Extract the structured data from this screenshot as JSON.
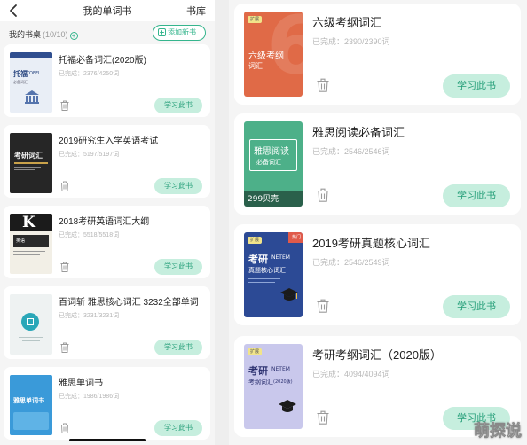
{
  "left": {
    "nav": {
      "title": "我的单词书",
      "library": "书库"
    },
    "shelf": {
      "label": "我的书桌",
      "count": "(10/10)",
      "plus": "+",
      "add_button": "添加新书"
    },
    "books": [
      {
        "name": "托福必备词汇(2020版)",
        "done": "已完成：2376/4250词",
        "study": "学习此书",
        "cover_title": "托福",
        "cover_sub": "TOEFL",
        "cover_note": "必备词汇"
      },
      {
        "name": "2019研究生入学英语考试",
        "done": "已完成：5197/5197词",
        "study": "学习此书",
        "cover_title": "考研词汇"
      },
      {
        "name": "2018考研英语词汇大纲",
        "done": "已完成：5518/5518词",
        "study": "学习此书",
        "cover_badge": "英语",
        "cover_letter": "K"
      },
      {
        "name": "百词斩 雅思核心词汇 3232全部单词",
        "done": "已完成：3231/3231词",
        "study": "学习此书"
      },
      {
        "name": "雅思单词书",
        "done": "已完成：1986/1986词",
        "study": "学习此书",
        "cover_title": "雅思单词书"
      }
    ]
  },
  "right": {
    "books": [
      {
        "name": "六级考纲词汇",
        "done": "已完成：2390/2390词",
        "study": "学习此书",
        "cover_title": "六级考纲",
        "cover_sub": "词汇",
        "cover_num": "6",
        "tag": "扩展"
      },
      {
        "name": "雅思阅读必备词汇",
        "done": "已完成：2546/2546词",
        "study": "学习此书",
        "cover_title": "雅思阅读",
        "cover_sub": "必备词汇",
        "cover_shells": "299贝壳"
      },
      {
        "name": "2019考研真题核心词汇",
        "done": "已完成：2546/2549词",
        "study": "学习此书",
        "cover_title": "考研",
        "cover_en": "NETEM",
        "cover_sub": "真题核心词汇",
        "tag": "扩展",
        "cover_ribbon": "热门"
      },
      {
        "name": "考研考纲词汇（2020版）",
        "done": "已完成：4094/4094词",
        "study": "学习此书",
        "cover_title": "考研",
        "cover_en": "NETEM",
        "cover_sub": "考纲词汇",
        "cover_year": "(2020版)",
        "tag": "扩展"
      }
    ]
  },
  "watermark": "萌探说",
  "colors": {
    "accent": "#35b58d",
    "study_bg": "#c6eede",
    "study_text": "#269f79"
  }
}
